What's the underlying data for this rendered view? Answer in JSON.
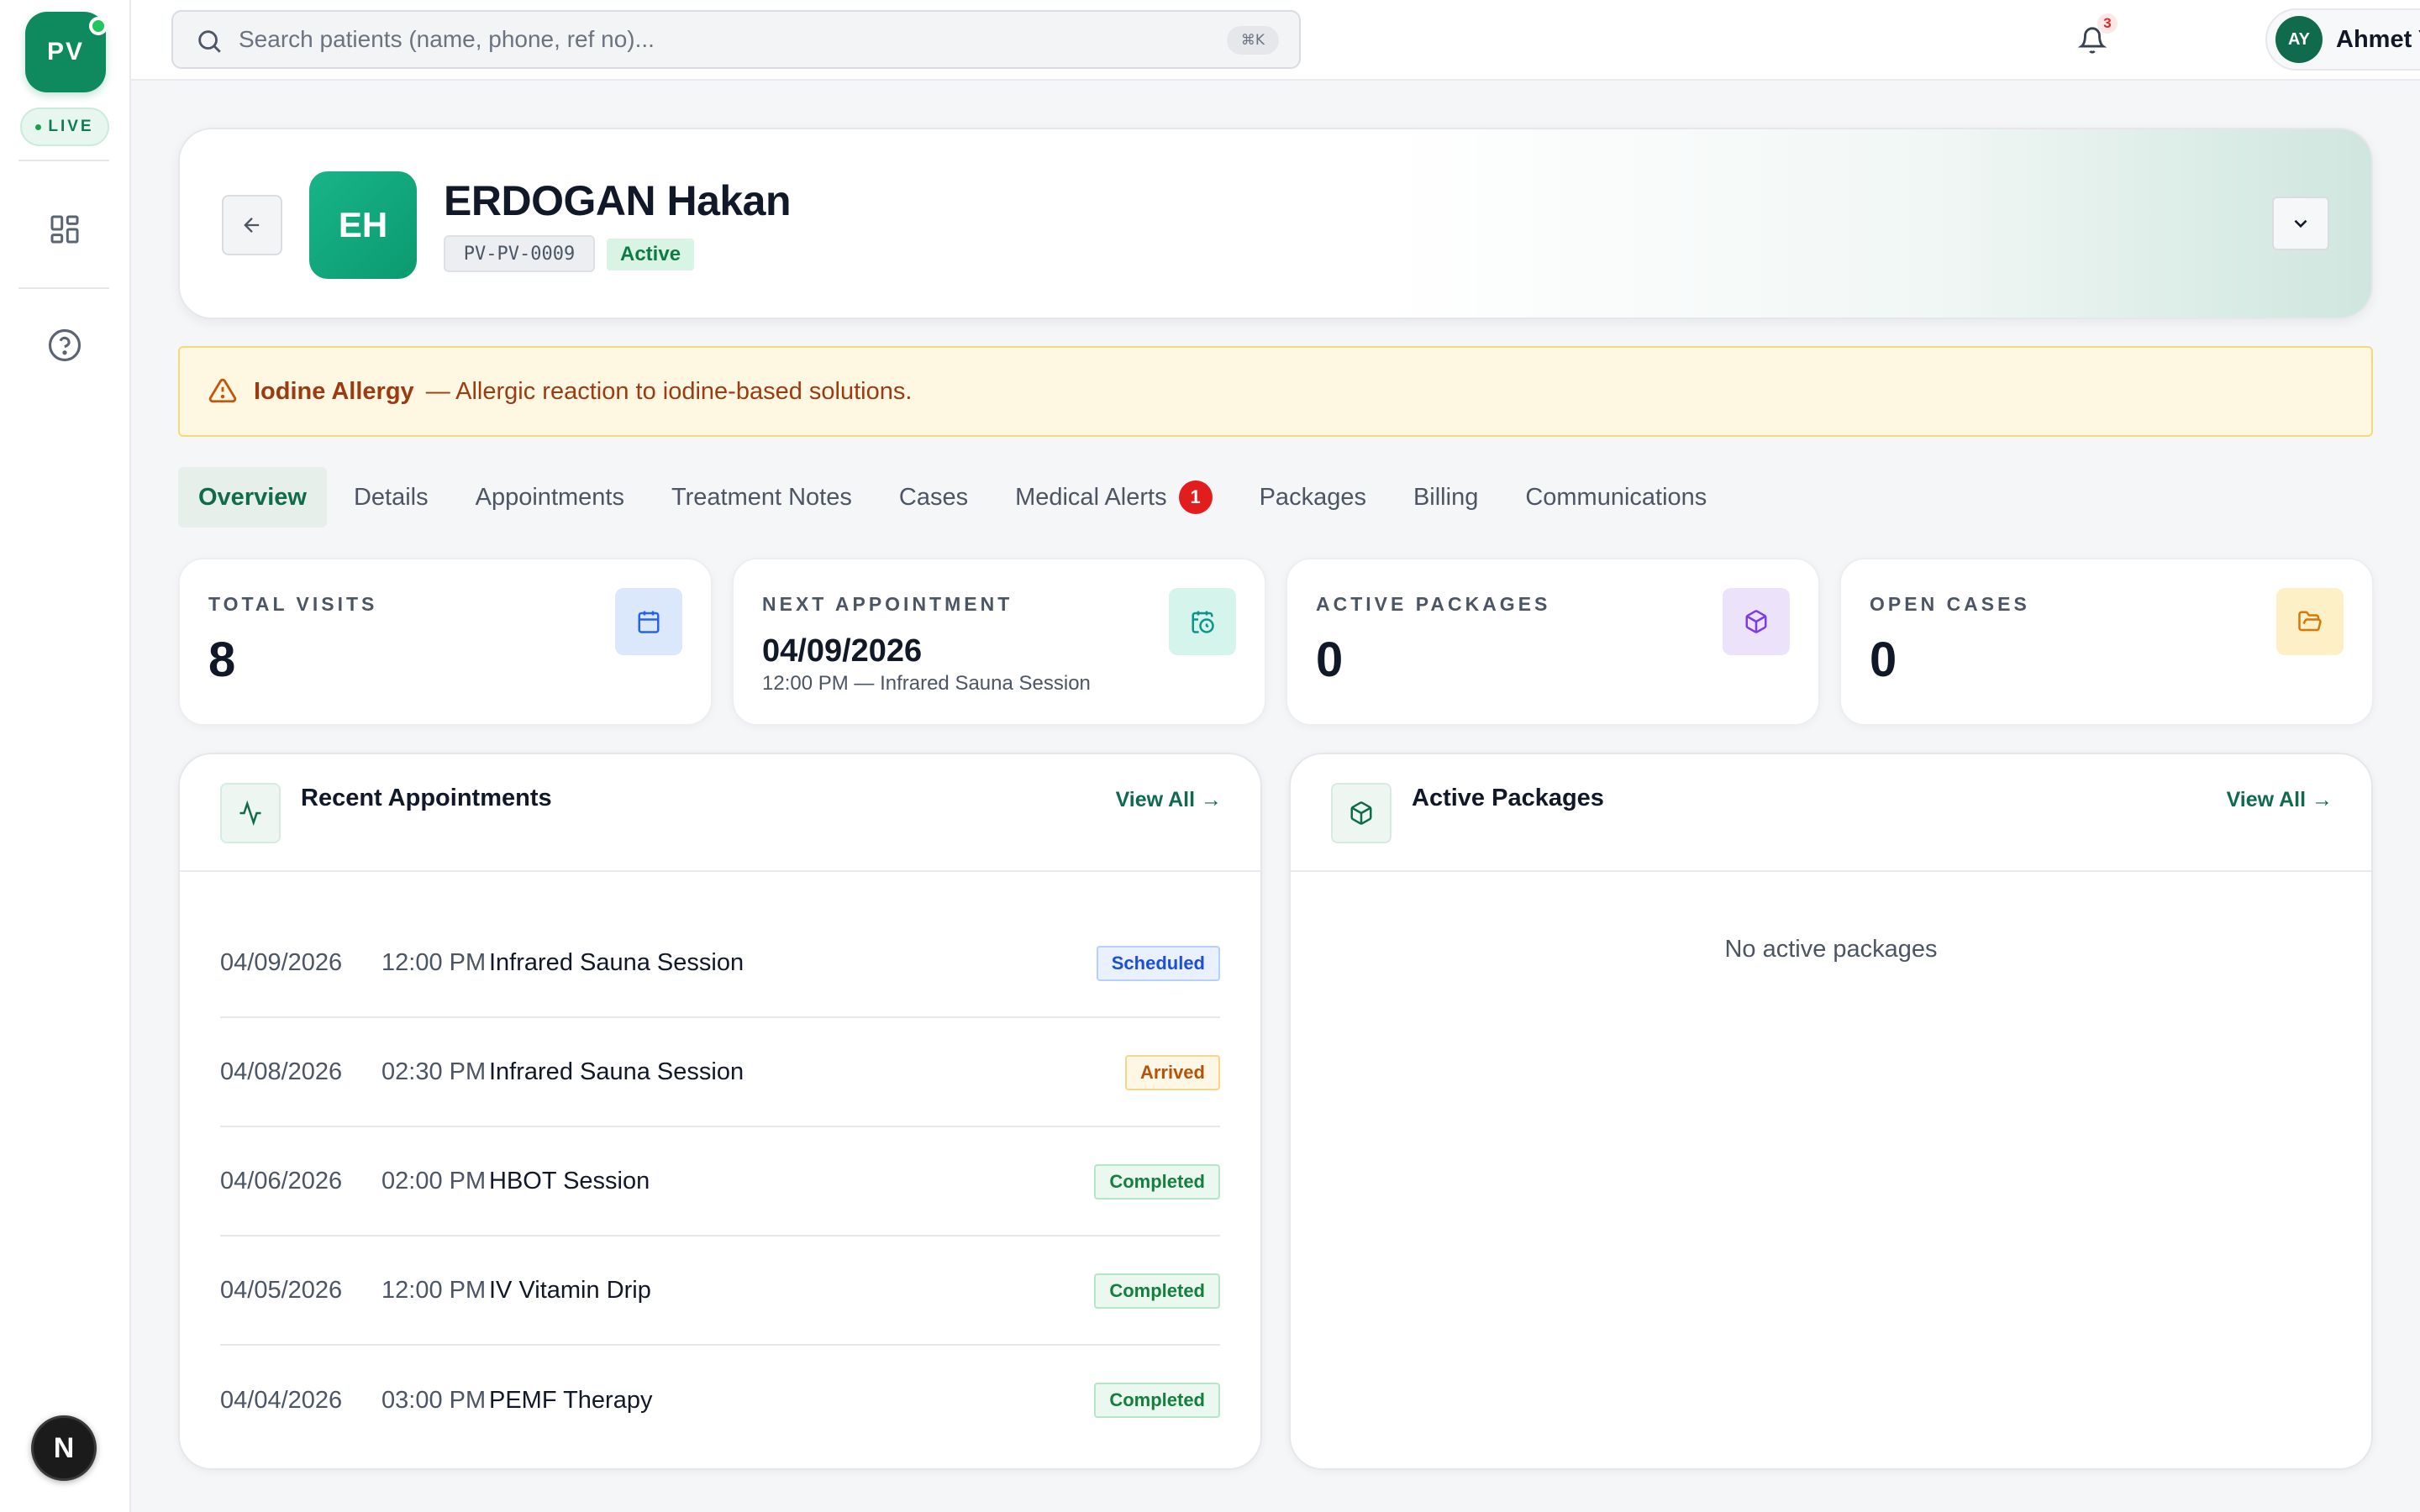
{
  "sidebar": {
    "logo": "PV",
    "live": "LIVE",
    "items": [
      {
        "icon": "dashboard-grid-icon"
      },
      {
        "icon": "help-circle-icon"
      }
    ],
    "bottom_button": "N"
  },
  "topbar": {
    "search_placeholder": "Search patients (name, phone, ref no)...",
    "shortcut": "⌘K",
    "notification_count": "3",
    "user": {
      "initials": "AY",
      "name": "Ahmet Yilmaz"
    }
  },
  "patient": {
    "initials": "EH",
    "name": "ERDOGAN Hakan",
    "id": "PV-PV-0009",
    "status": "Active"
  },
  "alert": {
    "title": "Iodine Allergy",
    "text": "— Allergic reaction to iodine-based solutions."
  },
  "tabs": [
    {
      "label": "Overview",
      "active": true
    },
    {
      "label": "Details"
    },
    {
      "label": "Appointments"
    },
    {
      "label": "Treatment Notes"
    },
    {
      "label": "Cases"
    },
    {
      "label": "Medical Alerts",
      "badge": "1"
    },
    {
      "label": "Packages"
    },
    {
      "label": "Billing"
    },
    {
      "label": "Communications"
    }
  ],
  "stats": [
    {
      "label": "TOTAL VISITS",
      "value": "8",
      "icon": "calendar-icon",
      "color": "#dbe7fb"
    },
    {
      "label": "NEXT APPOINTMENT",
      "value": "04/09/2026",
      "sub": "12:00 PM — Infrared Sauna Session",
      "icon": "calendar-clock-icon",
      "color": "#d5f5ec"
    },
    {
      "label": "ACTIVE PACKAGES",
      "value": "0",
      "icon": "package-icon",
      "color": "#ece3fb"
    },
    {
      "label": "OPEN CASES",
      "value": "0",
      "icon": "folder-open-icon",
      "color": "#fdf0c7"
    }
  ],
  "recent_appointments": {
    "title": "Recent Appointments",
    "view_all": "View All →",
    "rows": [
      {
        "date": "04/09/2026",
        "time": "12:00 PM",
        "service": "Infrared Sauna Session",
        "status": "Scheduled"
      },
      {
        "date": "04/08/2026",
        "time": "02:30 PM",
        "service": "Infrared Sauna Session",
        "status": "Arrived"
      },
      {
        "date": "04/06/2026",
        "time": "02:00 PM",
        "service": "HBOT Session",
        "status": "Completed"
      },
      {
        "date": "04/05/2026",
        "time": "12:00 PM",
        "service": "IV Vitamin Drip",
        "status": "Completed"
      },
      {
        "date": "04/04/2026",
        "time": "03:00 PM",
        "service": "PEMF Therapy",
        "status": "Completed"
      }
    ]
  },
  "active_packages": {
    "title": "Active Packages",
    "view_all": "View All →",
    "empty": "No active packages"
  }
}
